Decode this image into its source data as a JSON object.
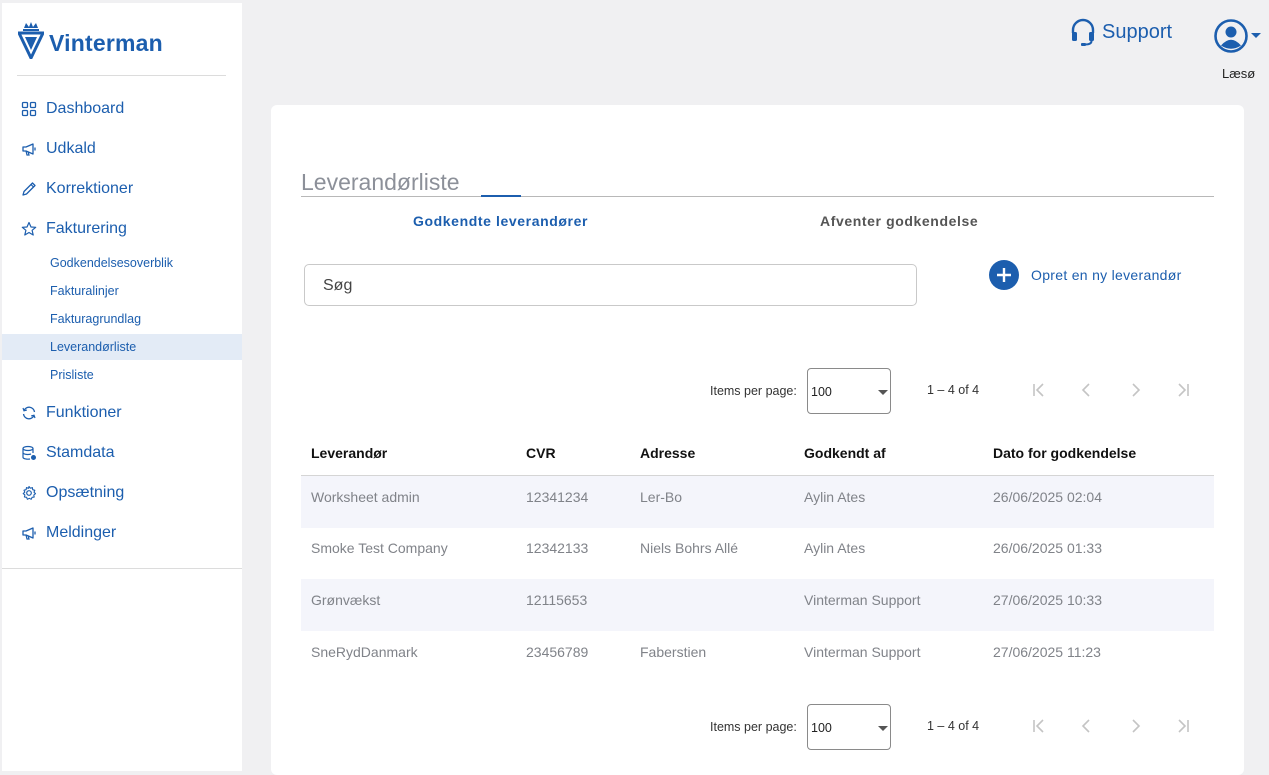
{
  "brand": {
    "name": "Vinterman"
  },
  "sidebar": {
    "items": [
      {
        "label": "Dashboard",
        "icon": "grid-icon"
      },
      {
        "label": "Udkald",
        "icon": "megaphone-icon"
      },
      {
        "label": "Korrektioner",
        "icon": "pencil-icon"
      },
      {
        "label": "Fakturering",
        "icon": "star-icon"
      }
    ],
    "subitems": [
      {
        "label": "Godkendelsesoverblik"
      },
      {
        "label": "Fakturalinjer"
      },
      {
        "label": "Fakturagrundlag"
      },
      {
        "label": "Leverandørliste",
        "active": true
      },
      {
        "label": "Prisliste"
      }
    ],
    "items2": [
      {
        "label": "Funktioner",
        "icon": "sync-icon"
      },
      {
        "label": "Stamdata",
        "icon": "database-icon"
      },
      {
        "label": "Opsætning",
        "icon": "gear-icon"
      },
      {
        "label": "Meldinger",
        "icon": "megaphone-icon"
      }
    ]
  },
  "header": {
    "support_label": "Support",
    "user_name": "Læsø"
  },
  "page": {
    "title": "Leverandørliste",
    "tabs": [
      {
        "label": "Godkendte leverandører",
        "active": true
      },
      {
        "label": "Afventer godkendelse",
        "active": false
      }
    ],
    "search": {
      "placeholder": "Søg",
      "value": ""
    },
    "create_label": "Opret en ny leverandør"
  },
  "paginator": {
    "items_per_page_label": "Items per page:",
    "page_size": "100",
    "range_label": "1 – 4 of 4"
  },
  "table": {
    "columns": [
      "Leverandør",
      "CVR",
      "Adresse",
      "Godkendt af",
      "Dato for godkendelse"
    ],
    "rows": [
      [
        "Worksheet admin",
        "12341234",
        "Ler-Bo",
        "Aylin Ates",
        "26/06/2025 02:04"
      ],
      [
        "Smoke Test Company",
        "12342133",
        "Niels Bohrs Allé",
        "Aylin Ates",
        "26/06/2025 01:33"
      ],
      [
        "Grønvækst",
        "12115653",
        "",
        "Vinterman Support",
        "27/06/2025 10:33"
      ],
      [
        "SneRydDanmark",
        "23456789",
        "Faberstien",
        "Vinterman Support",
        "27/06/2025 11:23"
      ]
    ]
  },
  "colors": {
    "accent": "#1c5eae",
    "active_bg": "#e3ebf6",
    "row_shade": "#f4f5fb",
    "background": "#f0f0f2"
  }
}
